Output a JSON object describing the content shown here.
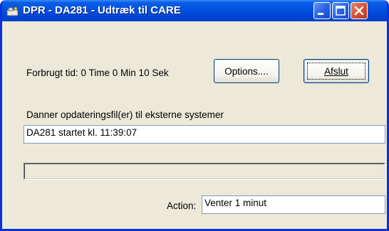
{
  "window": {
    "title": "DPR - DA281 - Udtræk til CARE",
    "icon": "program-icon",
    "controls": {
      "minimize": "minimize-icon",
      "maximize": "maximize-icon",
      "close": "close-icon"
    }
  },
  "header": {
    "time_label": "Forbrugt tid: 0 Time 0 Min 10 Sek",
    "options_button": "Options....",
    "exit_button": "Afslut"
  },
  "status": {
    "label": "Danner opdateringsfil(er) til eksterne systemer",
    "value": "DA281 startet kl. 11:39:07"
  },
  "progress": {
    "value": 0
  },
  "action": {
    "label": "Action:",
    "value": "Venter 1 minut"
  },
  "colors": {
    "titlebar": "#0054e3",
    "window_bg": "#ece9d8",
    "close_button": "#d4512e"
  }
}
